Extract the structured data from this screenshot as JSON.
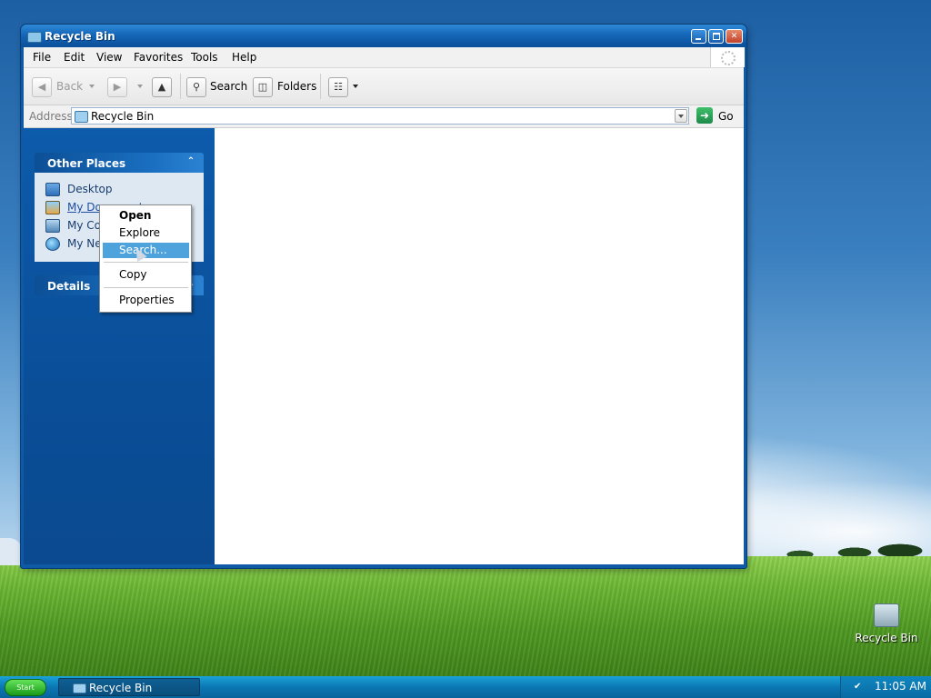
{
  "window": {
    "title": "Recycle Bin",
    "menus": [
      "File",
      "Edit",
      "View",
      "Favorites",
      "Tools",
      "Help"
    ],
    "toolbar": {
      "back_label": "Back",
      "search_label": "Search",
      "folders_label": "Folders"
    },
    "address": {
      "label": "Address",
      "value": "Recycle Bin",
      "go_label": "Go"
    }
  },
  "sidebar": {
    "other_places": {
      "title": "Other Places",
      "items": [
        {
          "label": "Desktop",
          "icon": "desktop-icon"
        },
        {
          "label": "My Documents",
          "icon": "my-documents-icon"
        },
        {
          "label": "My Computer",
          "icon": "my-computer-icon"
        },
        {
          "label": "My Network Places",
          "icon": "network-places-icon"
        }
      ]
    },
    "details": {
      "title": "Details"
    }
  },
  "context_menu": {
    "items": [
      "Open",
      "Explore",
      "Search...",
      "Copy",
      "Properties"
    ],
    "default_item": "Open",
    "highlighted_item": "Search..."
  },
  "desktop": {
    "icon_label": "Recycle Bin"
  },
  "taskbar": {
    "start_label": "Start",
    "task_label": "Recycle Bin",
    "clock": "11:05 AM"
  },
  "colors": {
    "sidebar_blue": "#0b4f98",
    "highlight": "#4fa3dc",
    "taskbar": "#0b77b3"
  }
}
